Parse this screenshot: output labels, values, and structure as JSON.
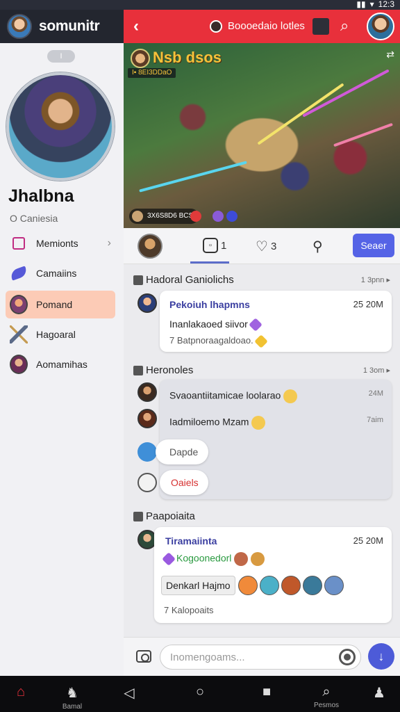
{
  "status_bar": {
    "time": "12:3"
  },
  "app": {
    "name": "somunitr"
  },
  "profile": {
    "name": "Jhalbna",
    "subtitle": "O Caniesia",
    "handle_badge": "I"
  },
  "sidebar": {
    "items": [
      {
        "label": "Memionts",
        "icon": "folder-icon"
      },
      {
        "label": "Camaiins",
        "icon": "feather-icon"
      },
      {
        "label": "Pomand",
        "icon": "avatar-icon",
        "active": true
      },
      {
        "label": "Hagoaral",
        "icon": "sword-icon"
      },
      {
        "label": "Aomamihas",
        "icon": "avatar-icon"
      }
    ]
  },
  "channel": {
    "title": "Boooedaio lotles",
    "back": "‹"
  },
  "game": {
    "title": "Nsb dsos",
    "subtitle": "I▪ 8EI3DDaO",
    "footer": "3X6S8D6 BCS"
  },
  "tabs": {
    "items": [
      {
        "label": "1"
      },
      {
        "label": "3"
      }
    ],
    "search_label": "Seaer"
  },
  "feed": {
    "sections": [
      {
        "title": "Hadoral Ganiolichs",
        "time": "1 3pnn ▸",
        "cards": [
          {
            "name": "Pekoiuh lhapmns",
            "time": "25 20M",
            "text": "Inanlakaoed siivor",
            "sub": "7 Batpnoraagaldoao."
          }
        ]
      },
      {
        "title": "Heronoles",
        "time": "1 3om ▸",
        "messages": [
          {
            "text": "Svaoantiitamicae loolarao",
            "time": "24M"
          },
          {
            "text": "Iadmiloemo Mzam",
            "time": "7aim"
          }
        ],
        "pills": [
          "Dapde",
          "Oaiels"
        ]
      },
      {
        "title": "Paapoiaita",
        "cards": [
          {
            "name": "Tiramaiinta",
            "time": "25 20M",
            "text": "Kogoonedorl",
            "tag": "Denkarl Hajmo",
            "sub": "7 Kalopoaits"
          }
        ]
      }
    ]
  },
  "composer": {
    "placeholder": "Inomengoams..."
  },
  "navbar": {
    "items": [
      {
        "label": ""
      },
      {
        "label": "Bamal"
      },
      {
        "label": ""
      },
      {
        "label": ""
      },
      {
        "label": ""
      },
      {
        "label": "Pesmos"
      },
      {
        "label": ""
      }
    ]
  },
  "colors": {
    "accent": "#e8303b",
    "primary": "#5563e6",
    "active_item": "#fccbb6"
  }
}
